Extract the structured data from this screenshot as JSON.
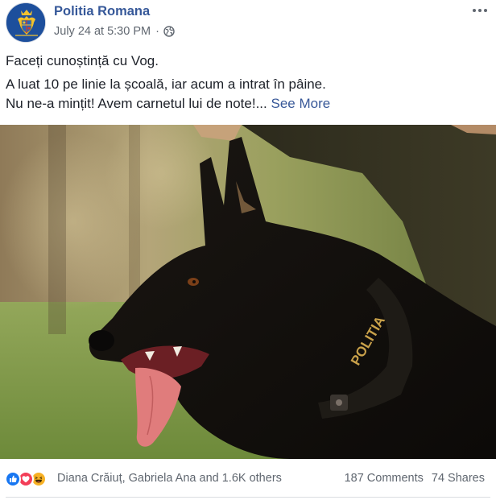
{
  "header": {
    "page_name": "Politia Romana",
    "timestamp": "July 24 at 5:30 PM",
    "separator": "·",
    "privacy_icon": "globe-icon",
    "avatar_icon": "coat-of-arms-icon",
    "more_icon": "more-options-icon"
  },
  "post": {
    "line1": "Faceți cunoștință cu Vog.",
    "line2": "A luat 10 pe linie la școală, iar acum a intrat în pâine.",
    "line3": "Nu ne-a mințit! Avem carnetul lui de note!...",
    "see_more": "See More",
    "photo": "police-dog-photo",
    "collar_text": "POLITIA"
  },
  "footer": {
    "reactions": [
      "like",
      "love",
      "haha"
    ],
    "reaction_names": "Diana Crăiuț, Gabriela Ana and 1.6K others",
    "comments": "187 Comments",
    "shares": "74 Shares"
  },
  "colors": {
    "link": "#365899",
    "meta": "#606770",
    "text": "#1d2129",
    "like": "#1877f2",
    "love": "#f33e58",
    "haha": "#f7b125"
  }
}
